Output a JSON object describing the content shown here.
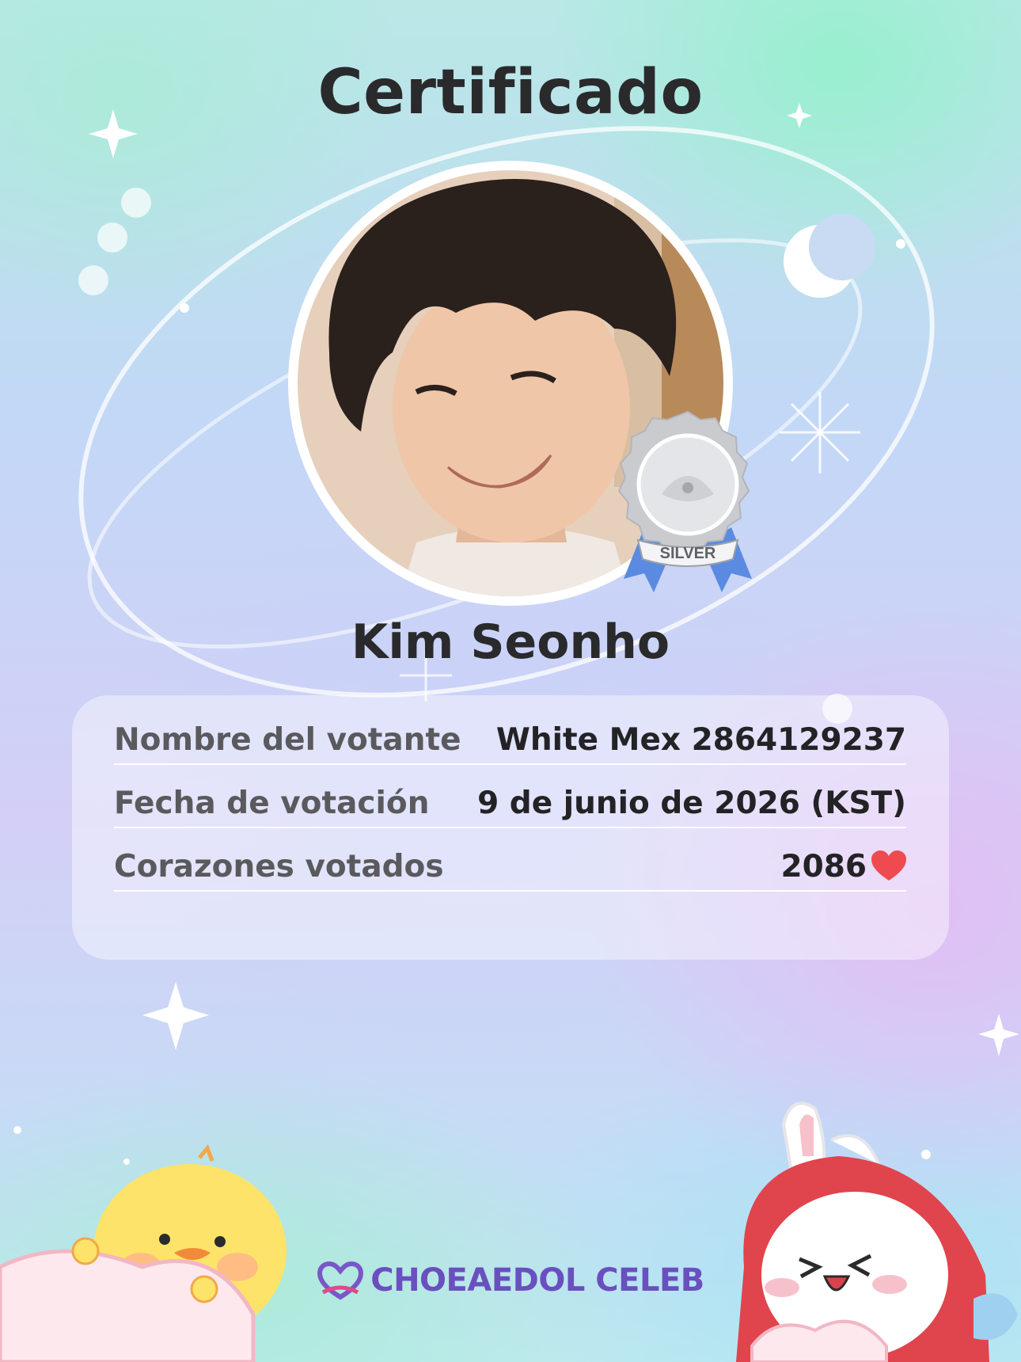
{
  "page": {
    "title": "Certificado",
    "celebrity_name": "Kim Seonho",
    "photo_description": "portrait-photo"
  },
  "badge": {
    "label": "SILVER",
    "icon": "silver-medal-icon"
  },
  "info": {
    "voter_label": "Nombre del votante",
    "voter_value": "White Mex 2864129237",
    "date_label": "Fecha de votación",
    "date_value": "9 de junio de 2026 (KST)",
    "hearts_label": "Corazones votados",
    "hearts_value": "2086",
    "hearts_icon": "heart-icon"
  },
  "brand": {
    "name": "CHOEAEDOL CELEB",
    "logo_icon": "choeaedol-heart-logo-icon"
  },
  "colors": {
    "title_text": "#2a2a2c",
    "label_text": "#5a5a5e",
    "value_text": "#232326",
    "brand_purple": "#6a4fbf",
    "heart_red": "#ef4a4f",
    "medal_silver": "#c9cbcf",
    "ribbon_blue": "#5a8be0"
  }
}
